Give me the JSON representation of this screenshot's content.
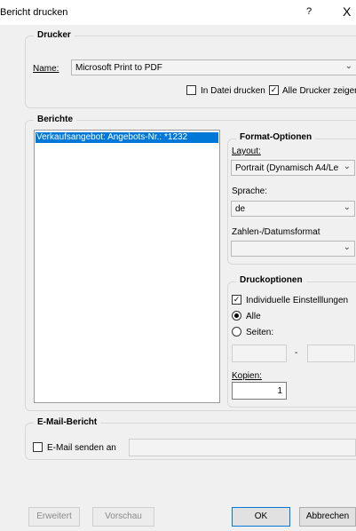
{
  "window": {
    "title": "Bericht drucken",
    "help_label": "?",
    "close_label": "X"
  },
  "drucker": {
    "legend": "Drucker",
    "name_label": "Name:",
    "printer_value": "Microsoft Print to PDF",
    "in_datei_label": "In Datei drucken",
    "in_datei_checked": false,
    "alle_drucker_label": "Alle Drucker zeigen",
    "alle_drucker_checked": true
  },
  "berichte": {
    "legend": "Berichte",
    "items": [
      "Verkaufsangebot: Angebots-Nr.: *1232"
    ]
  },
  "format": {
    "legend": "Format-Optionen",
    "layout_label": "Layout:",
    "layout_value": "Portrait (Dynamisch A4/Le",
    "sprache_label": "Sprache:",
    "sprache_value": "de",
    "zahlen_label": "Zahlen-/Datumsformat",
    "zahlen_value": ""
  },
  "druck": {
    "legend": "Druckoptionen",
    "individuell_label": "Individuelle Einstelllungen",
    "individuell_checked": true,
    "alle_label": "Alle",
    "seiten_label": "Seiten:",
    "selected_range": "Alle",
    "from_value": "",
    "dash": "-",
    "to_value": "",
    "kopien_label": "Kopien:",
    "kopien_value": "1"
  },
  "email": {
    "legend": "E-Mail-Bericht",
    "send_label": "E-Mail senden an",
    "send_checked": false,
    "address_value": ""
  },
  "buttons": {
    "erweitert": "Erweitert",
    "vorschau": "Vorschau",
    "ok": "OK",
    "abbrechen": "Abbrechen"
  }
}
